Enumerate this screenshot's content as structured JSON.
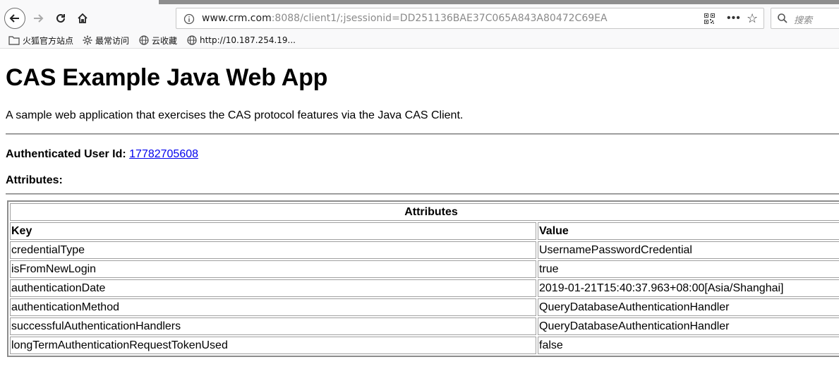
{
  "browser": {
    "url_host": "www.crm.com",
    "url_rest": ":8088/client1/;jsessionid=DD251136BAE37C065A843A80472C69EA",
    "search_placeholder": "搜索",
    "bookmarks": [
      {
        "label": "火狐官方站点",
        "icon": "folder-icon"
      },
      {
        "label": "最常访问",
        "icon": "gear-icon"
      },
      {
        "label": "云收藏",
        "icon": "globe-icon"
      },
      {
        "label": "http://10.187.254.19...",
        "icon": "globe-icon"
      }
    ]
  },
  "page": {
    "title": "CAS Example Java Web App",
    "description": "A sample web application that exercises the CAS protocol features via the Java CAS Client.",
    "user_label": "Authenticated User Id:",
    "user_id": "17782705608",
    "attributes_heading": "Attributes:"
  },
  "table": {
    "caption": "Attributes",
    "key_header": "Key",
    "value_header": "Value",
    "rows": [
      {
        "key": "credentialType",
        "value": "UsernamePasswordCredential"
      },
      {
        "key": "isFromNewLogin",
        "value": "true"
      },
      {
        "key": "authenticationDate",
        "value": "2019-01-21T15:40:37.963+08:00[Asia/Shanghai]"
      },
      {
        "key": "authenticationMethod",
        "value": "QueryDatabaseAuthenticationHandler"
      },
      {
        "key": "successfulAuthenticationHandlers",
        "value": "QueryDatabaseAuthenticationHandler"
      },
      {
        "key": "longTermAuthenticationRequestTokenUsed",
        "value": "false"
      }
    ]
  }
}
